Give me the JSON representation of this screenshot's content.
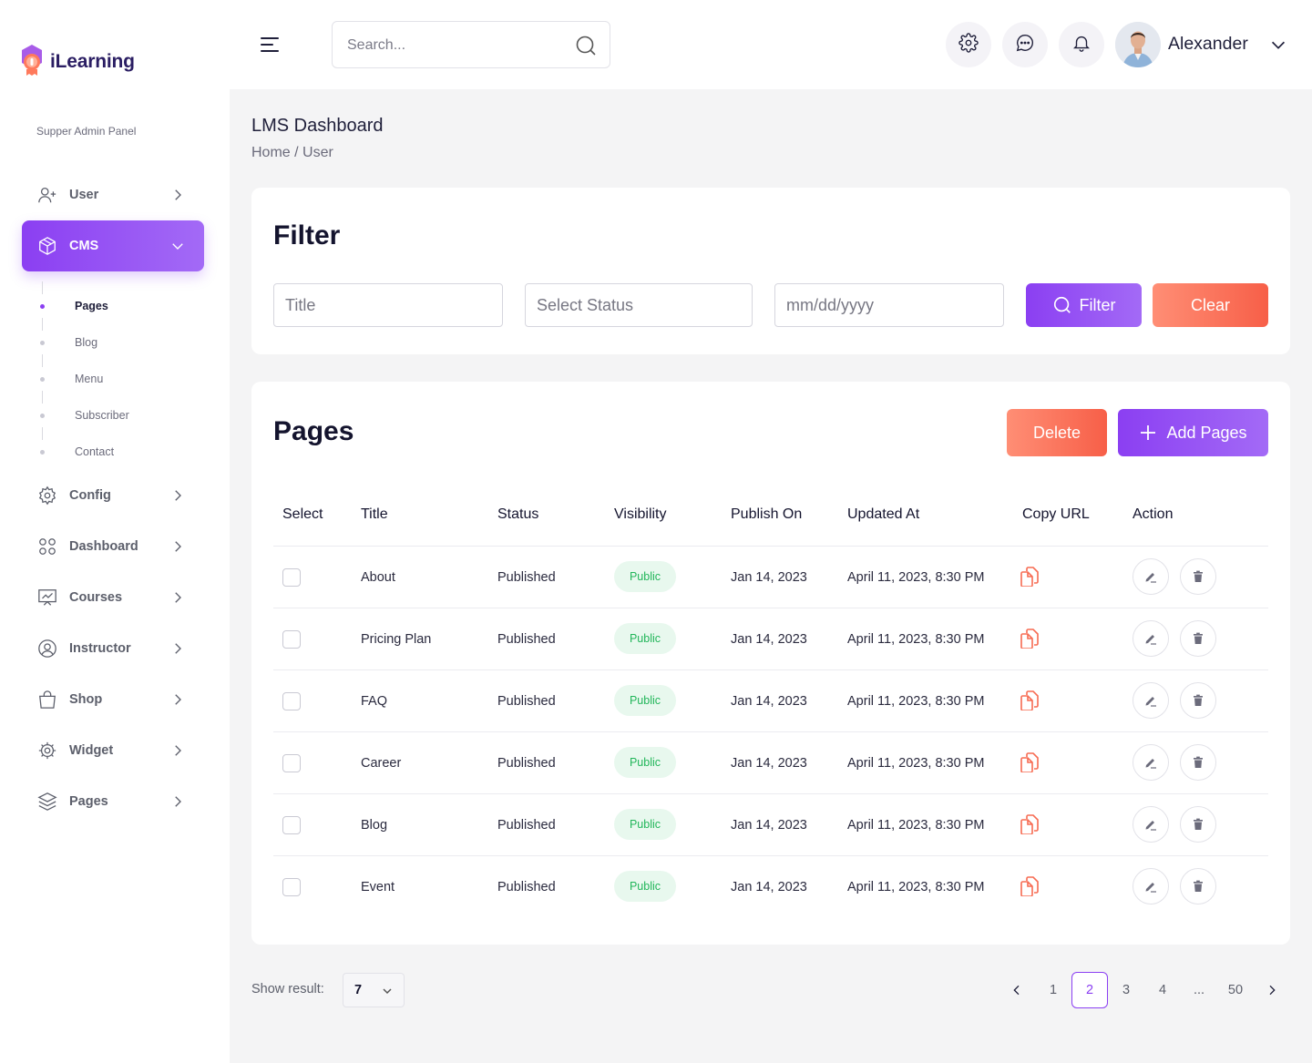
{
  "brand": {
    "name": "iLearning",
    "panel_label": "Supper Admin Panel"
  },
  "sidebar": {
    "items": [
      {
        "label": "User",
        "icon": "user-plus-icon"
      },
      {
        "label": "CMS",
        "icon": "box-icon",
        "active": true
      },
      {
        "label": "Config",
        "icon": "gear-icon"
      },
      {
        "label": "Dashboard",
        "icon": "grid-icon"
      },
      {
        "label": "Courses",
        "icon": "presentation-icon"
      },
      {
        "label": "Instructor",
        "icon": "user-circle-icon"
      },
      {
        "label": "Shop",
        "icon": "shopping-bag-icon"
      },
      {
        "label": "Widget",
        "icon": "widget-icon"
      },
      {
        "label": "Pages",
        "icon": "layers-icon"
      }
    ],
    "cms_sub": [
      "Pages",
      "Blog",
      "Menu",
      "Subscriber",
      "Contact"
    ]
  },
  "header": {
    "search_placeholder": "Search...",
    "user_name": "Alexander"
  },
  "page": {
    "title": "LMS Dashboard",
    "breadcrumb": "Home / User"
  },
  "filter": {
    "title": "Filter",
    "title_placeholder": "Title",
    "status_placeholder": "Select Status",
    "date_placeholder": "mm/dd/yyyy",
    "filter_label": "Filter",
    "clear_label": "Clear"
  },
  "pages": {
    "title": "Pages",
    "delete_label": "Delete",
    "add_label": "Add Pages",
    "columns": [
      "Select",
      "Title",
      "Status",
      "Visibility",
      "Publish On",
      "Updated At",
      "Copy URL",
      "Action"
    ],
    "rows": [
      {
        "title": "About",
        "status": "Published",
        "visibility": "Public",
        "publish_on": "Jan 14, 2023",
        "updated_at": "April 11, 2023, 8:30 PM"
      },
      {
        "title": "Pricing Plan",
        "status": "Published",
        "visibility": "Public",
        "publish_on": "Jan 14, 2023",
        "updated_at": "April 11, 2023, 8:30 PM"
      },
      {
        "title": "FAQ",
        "status": "Published",
        "visibility": "Public",
        "publish_on": "Jan 14, 2023",
        "updated_at": "April 11, 2023, 8:30 PM"
      },
      {
        "title": "Career",
        "status": "Published",
        "visibility": "Public",
        "publish_on": "Jan 14, 2023",
        "updated_at": "April 11, 2023, 8:30 PM"
      },
      {
        "title": "Blog",
        "status": "Published",
        "visibility": "Public",
        "publish_on": "Jan 14, 2023",
        "updated_at": "April 11, 2023, 8:30 PM"
      },
      {
        "title": "Event",
        "status": "Published",
        "visibility": "Public",
        "publish_on": "Jan 14, 2023",
        "updated_at": "April 11, 2023, 8:30 PM"
      }
    ]
  },
  "footer": {
    "show_label": "Show result:",
    "show_value": "7",
    "pages": [
      "1",
      "2",
      "3",
      "4",
      "...",
      "50"
    ],
    "current_page": "2"
  },
  "colors": {
    "accent": "#8b3ff2",
    "danger": "#f75f48",
    "success": "#22b65a"
  }
}
